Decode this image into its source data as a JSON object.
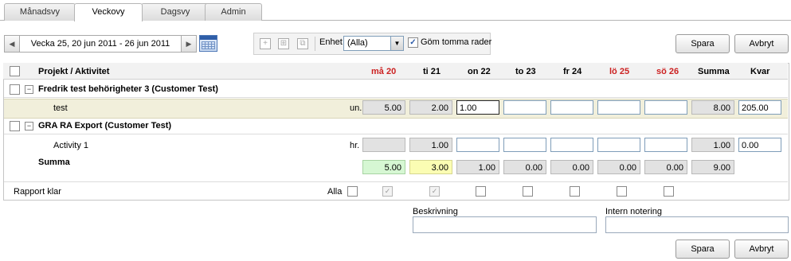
{
  "tabs": [
    {
      "label": "Månadsvy",
      "active": false
    },
    {
      "label": "Veckovy",
      "active": true
    },
    {
      "label": "Dagsvy",
      "active": false
    },
    {
      "label": "Admin",
      "active": false
    }
  ],
  "week_nav": {
    "label": "Vecka 25, 20 jun 2011 - 26 jun 2011",
    "prev_glyph": "◀",
    "next_glyph": "▶"
  },
  "toolbar": {
    "unit_label": "Enhet",
    "unit_select": {
      "value": "(Alla)"
    },
    "hide_empty": {
      "label": "Göm tomma rader",
      "checked": true
    },
    "save_label": "Spara",
    "cancel_label": "Avbryt"
  },
  "table": {
    "header_title": "Projekt / Aktivitet",
    "days": [
      {
        "label": "må 20",
        "weekend": true
      },
      {
        "label": "ti 21",
        "weekend": false
      },
      {
        "label": "on 22",
        "weekend": false
      },
      {
        "label": "to 23",
        "weekend": false
      },
      {
        "label": "fr 24",
        "weekend": false
      },
      {
        "label": "lö 25",
        "weekend": true
      },
      {
        "label": "sö 26",
        "weekend": true
      }
    ],
    "sum_header": "Summa",
    "left_header": "Kvar",
    "projects": [
      {
        "name": "Fredrik test behörigheter 3 (Customer Test)",
        "activity": {
          "name": "test",
          "unit": "un.",
          "values": [
            "5.00",
            "2.00",
            "1.00",
            "",
            "",
            "",
            ""
          ],
          "sum": "8.00",
          "left": "205.00"
        }
      },
      {
        "name": "GRA RA Export (Customer Test)",
        "activity": {
          "name": "Activity 1",
          "unit": "hr.",
          "values": [
            "",
            "1.00",
            "",
            "",
            "",
            "",
            ""
          ],
          "sum": "1.00",
          "left": "0.00"
        }
      }
    ],
    "total": {
      "label": "Summa",
      "values": [
        "5.00",
        "3.00",
        "1.00",
        "0.00",
        "0.00",
        "0.00",
        "0.00"
      ],
      "sum": "9.00"
    },
    "report": {
      "label": "Rapport klar",
      "all_label": "Alla",
      "days_checked": [
        true,
        true,
        false,
        false,
        false,
        false,
        false
      ]
    }
  },
  "notes": {
    "description_label": "Beskrivning",
    "internal_label": "Intern notering"
  },
  "colors": {
    "weekend": "#cc2222",
    "highlight_row": "#f1efdb",
    "total_green": "#d6f7d3",
    "total_yellow": "#fbfdb3"
  }
}
